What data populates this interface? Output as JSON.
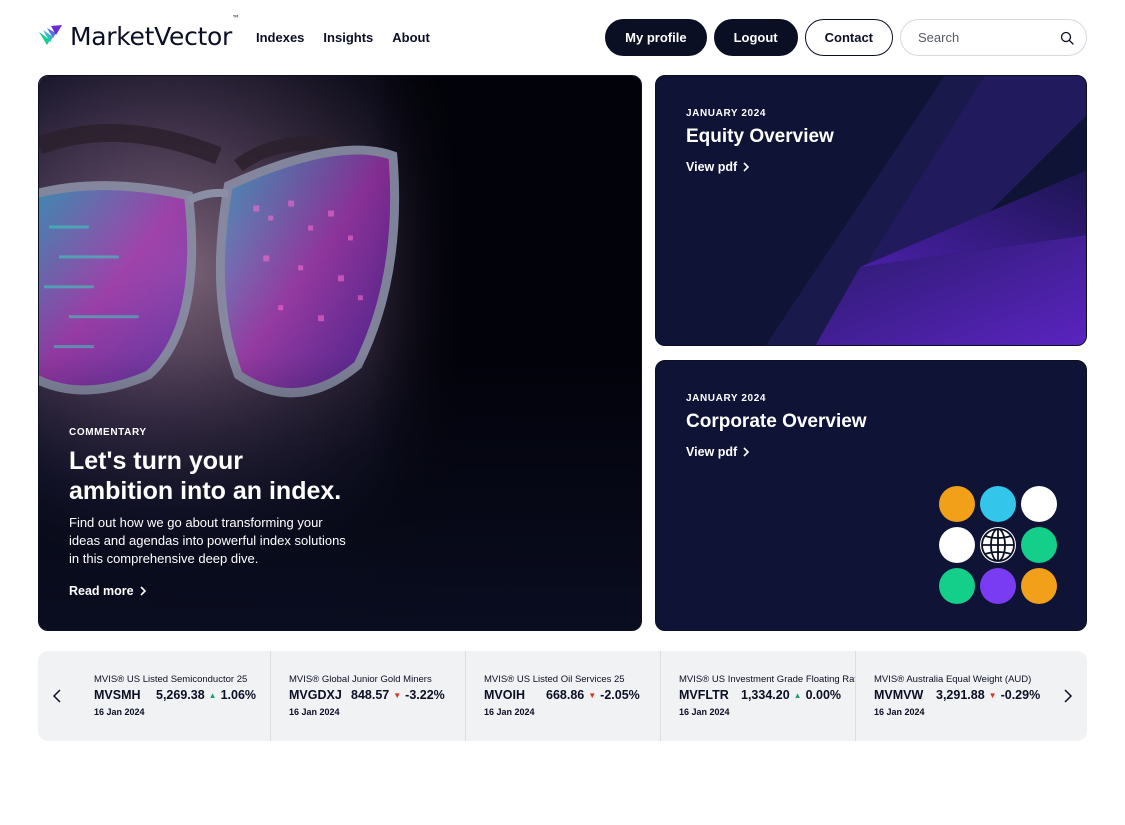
{
  "brand": {
    "name": "MarketVector",
    "tm": "™"
  },
  "nav": [
    {
      "label": "Indexes"
    },
    {
      "label": "Insights"
    },
    {
      "label": "About"
    }
  ],
  "header_actions": {
    "my_profile": "My profile",
    "logout": "Logout",
    "contact": "Contact",
    "search_placeholder": "Search"
  },
  "hero": {
    "eyebrow": "COMMENTARY",
    "title_line1": "Let's turn your",
    "title_line2": "ambition into an index.",
    "desc_line1": "Find out how we go about transforming your",
    "desc_line2": "ideas and agendas into powerful index solutions",
    "desc_line3": "in this comprehensive deep dive.",
    "cta": "Read more"
  },
  "cards": [
    {
      "eyebrow": "JANUARY 2024",
      "title": "Equity Overview",
      "cta": "View pdf"
    },
    {
      "eyebrow": "JANUARY 2024",
      "title": "Corporate Overview",
      "cta": "View pdf"
    }
  ],
  "ticker": [
    {
      "name": "MVIS® US Listed Semiconductor 25",
      "symbol": "MVSMH",
      "value": "5,269.38",
      "direction": "up",
      "arrow": "▲",
      "change": "1.06%",
      "date": "16 Jan 2024"
    },
    {
      "name": "MVIS® Global Junior Gold Miners",
      "symbol": "MVGDXJ",
      "value": "848.57",
      "direction": "down",
      "arrow": "▼",
      "change": "-3.22%",
      "date": "16 Jan 2024"
    },
    {
      "name": "MVIS® US Listed Oil Services 25",
      "symbol": "MVOIH",
      "value": "668.86",
      "direction": "down",
      "arrow": "▼",
      "change": "-2.05%",
      "date": "16 Jan 2024"
    },
    {
      "name": "MVIS® US Investment Grade Floating Rate",
      "symbol": "MVFLTR",
      "value": "1,334.20",
      "direction": "up",
      "arrow": "▲",
      "change": "0.00%",
      "date": "16 Jan 2024"
    },
    {
      "name": "MVIS® Australia Equal Weight (AUD)",
      "symbol": "MVMVW",
      "value": "3,291.88",
      "direction": "down",
      "arrow": "▼",
      "change": "-0.29%",
      "date": "16 Jan 2024"
    }
  ],
  "colors": {
    "navy": "#0b0f24",
    "up": "#1f9e6e",
    "down": "#d8342a",
    "purple": "#6a2bd9",
    "orange": "#f2a01a",
    "cyan": "#33c6ea",
    "green": "#13cf8a",
    "violet": "#7a3cf2"
  },
  "icons": {
    "logo": "marketvector-chevron-logo-icon",
    "search": "search-icon",
    "chevron_right": "chevron-right-icon",
    "chevron_left": "chevron-left-icon",
    "globe": "globe-icon"
  }
}
